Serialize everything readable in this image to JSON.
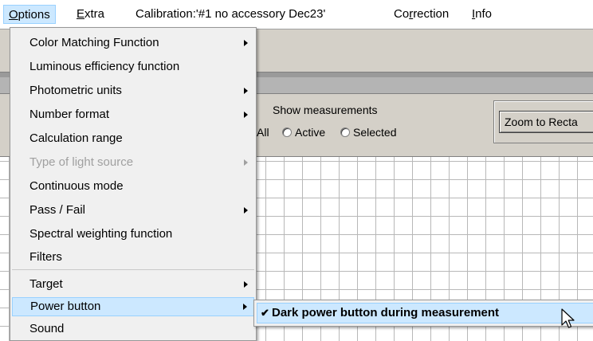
{
  "menubar": {
    "items": [
      {
        "pre": "",
        "ul": "O",
        "post": "ptions"
      },
      {
        "pre": "",
        "ul": "E",
        "post": "xtra"
      },
      {
        "pre": "Calibration:'#1  no accessory Dec23'",
        "ul": "",
        "post": ""
      },
      {
        "pre": "Co",
        "ul": "r",
        "post": "rection"
      },
      {
        "pre": "",
        "ul": "I",
        "post": "nfo"
      }
    ]
  },
  "background": {
    "show_measurements": "Show measurements",
    "all_label": "All",
    "active_label": "Active",
    "selected_label": "Selected",
    "zoom_button": "Zoom to Recta"
  },
  "options_menu": {
    "items": [
      {
        "label": "Color Matching Function",
        "submenu": true,
        "disabled": false
      },
      {
        "label": "Luminous efficiency function",
        "submenu": false,
        "disabled": false
      },
      {
        "label": "Photometric units",
        "submenu": true,
        "disabled": false
      },
      {
        "label": "Number format",
        "submenu": true,
        "disabled": false
      },
      {
        "label": "Calculation range",
        "submenu": false,
        "disabled": false
      },
      {
        "label": "Type of light source",
        "submenu": true,
        "disabled": true
      },
      {
        "label": "Continuous mode",
        "submenu": false,
        "disabled": false
      },
      {
        "label": "Pass / Fail",
        "submenu": true,
        "disabled": false
      },
      {
        "label": "Spectral weighting function",
        "submenu": false,
        "disabled": false
      },
      {
        "label": "Filters",
        "submenu": false,
        "disabled": false
      },
      {
        "label": "Target",
        "submenu": true,
        "disabled": false
      },
      {
        "label": "Power button",
        "submenu": true,
        "disabled": false,
        "highlighted": true
      },
      {
        "label": "Sound",
        "submenu": false,
        "disabled": false
      }
    ]
  },
  "power_submenu": {
    "checkmark": "✔",
    "item_label": "Dark power button during measurement",
    "checked": true
  },
  "colors": {
    "highlight": "#cce8ff",
    "highlight_border": "#99d1ff",
    "menu_bg": "#f0f0f0",
    "disabled_text": "#a0a0a0"
  }
}
